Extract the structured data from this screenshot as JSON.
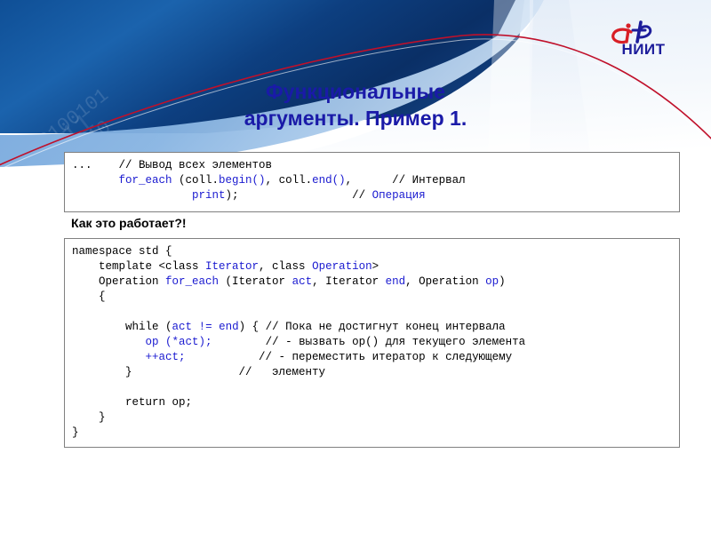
{
  "slide": {
    "title_lines": [
      "Функциональные",
      "аргументы. Пример 1."
    ],
    "caption": "Как это работает?!",
    "title_color": "#1a1aa8",
    "accent_red": "#c0102a",
    "banner_blue_dark": "#0b3b7a",
    "banner_blue_light": "#5b93d6",
    "code_blue": "#1a1ad0"
  },
  "logo": {
    "letter_i": "i",
    "letter_t": "t",
    "word": "НИИТ",
    "red": "#d81f26",
    "blue": "#1d1d9b"
  },
  "code_top": {
    "lines": [
      [
        {
          "t": "...    ",
          "c": "bk"
        },
        {
          "t": "// Вывод всех элементов",
          "c": "bk"
        }
      ],
      [
        {
          "t": "       ",
          "c": "bk"
        },
        {
          "t": "for_each",
          "c": "kw"
        },
        {
          "t": " (coll.",
          "c": "bk"
        },
        {
          "t": "begin()",
          "c": "kw"
        },
        {
          "t": ", coll.",
          "c": "bk"
        },
        {
          "t": "end()",
          "c": "kw"
        },
        {
          "t": ",      ",
          "c": "bk"
        },
        {
          "t": "// Интервал",
          "c": "bk"
        }
      ],
      [
        {
          "t": "                  ",
          "c": "bk"
        },
        {
          "t": "print",
          "c": "kw"
        },
        {
          "t": ");",
          "c": "bk"
        },
        {
          "t": "                 ",
          "c": "bk"
        },
        {
          "t": "// ",
          "c": "bk"
        },
        {
          "t": "Операция",
          "c": "kw"
        }
      ]
    ]
  },
  "code_main": {
    "lines": [
      [
        {
          "t": "namespace std {",
          "c": "bk"
        }
      ],
      [
        {
          "t": "    template <class ",
          "c": "bk"
        },
        {
          "t": "Iterator",
          "c": "kw"
        },
        {
          "t": ", class ",
          "c": "bk"
        },
        {
          "t": "Operation",
          "c": "kw"
        },
        {
          "t": ">",
          "c": "bk"
        }
      ],
      [
        {
          "t": "    Operation ",
          "c": "bk"
        },
        {
          "t": "for_each",
          "c": "kw"
        },
        {
          "t": " (Iterator ",
          "c": "bk"
        },
        {
          "t": "act",
          "c": "kw"
        },
        {
          "t": ", Iterator ",
          "c": "bk"
        },
        {
          "t": "end",
          "c": "kw"
        },
        {
          "t": ", Operation ",
          "c": "bk"
        },
        {
          "t": "op",
          "c": "kw"
        },
        {
          "t": ")",
          "c": "bk"
        }
      ],
      [
        {
          "t": "    {",
          "c": "bk"
        }
      ],
      [
        {
          "t": "",
          "c": "bk"
        }
      ],
      [
        {
          "t": "        while (",
          "c": "bk"
        },
        {
          "t": "act",
          "c": "kw"
        },
        {
          "t": " ",
          "c": "bk"
        },
        {
          "t": "!=",
          "c": "kw"
        },
        {
          "t": " ",
          "c": "bk"
        },
        {
          "t": "end",
          "c": "kw"
        },
        {
          "t": ") { // Пока не достигнут конец интервала",
          "c": "bk"
        }
      ],
      [
        {
          "t": "           ",
          "c": "bk"
        },
        {
          "t": "op",
          "c": "kw"
        },
        {
          "t": " ",
          "c": "bk"
        },
        {
          "t": "(*act);",
          "c": "kw"
        },
        {
          "t": "        // - вызвать op() для текущего элемента",
          "c": "bk"
        }
      ],
      [
        {
          "t": "           ",
          "c": "bk"
        },
        {
          "t": "++act;",
          "c": "kw"
        },
        {
          "t": "           // - переместить итератор к следующему",
          "c": "bk"
        }
      ],
      [
        {
          "t": "        }                //   элементу",
          "c": "bk"
        }
      ],
      [
        {
          "t": "",
          "c": "bk"
        }
      ],
      [
        {
          "t": "        return op;",
          "c": "bk"
        }
      ],
      [
        {
          "t": "    }",
          "c": "bk"
        }
      ],
      [
        {
          "t": "}",
          "c": "bk"
        }
      ]
    ]
  }
}
